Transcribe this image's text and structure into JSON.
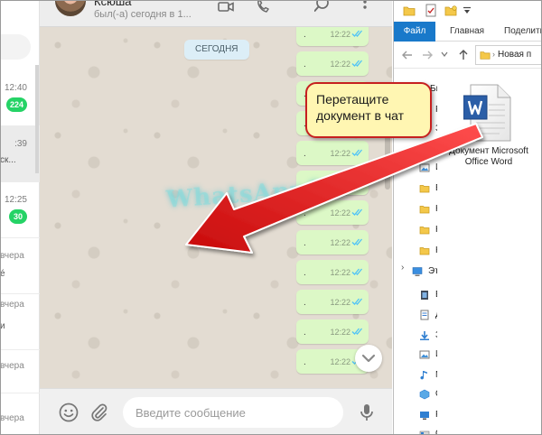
{
  "chat_list": {
    "rows": [
      {
        "time": "12:40",
        "badge": "224"
      },
      {
        "time": ":39",
        "snippet": "ск..."
      },
      {
        "time": "12:25",
        "badge": "30"
      },
      {
        "day": "вчера",
        "snippet": "é"
      },
      {
        "day": "вчера",
        "snippet": "и"
      },
      {
        "day": "вчера"
      },
      {
        "day": "вчера"
      }
    ]
  },
  "chat_header": {
    "contact_name": "Ксюша",
    "last_seen": "был(-а) сегодня в 1..."
  },
  "chat": {
    "date_divider": "СЕГОДНЯ",
    "message_time": "12:22",
    "message_dot": "."
  },
  "composer": {
    "placeholder": "Введите сообщение"
  },
  "watermark": "WhatsApp0a",
  "callout": {
    "text": "Перетащите документ в чат"
  },
  "explorer": {
    "tabs": [
      "Файл",
      "Главная",
      "Поделить"
    ],
    "address": "Новая п",
    "nav_items": [
      {
        "label": "Быстр",
        "icon": "quick-access-icon"
      },
      {
        "label": "Ра",
        "icon": "desktop-icon"
      },
      {
        "label": "За",
        "icon": "downloads-icon"
      },
      {
        "label": "Из",
        "icon": "images-icon"
      },
      {
        "label": "Вс",
        "icon": "folder-icon"
      },
      {
        "label": "Ка",
        "icon": "folder-icon"
      },
      {
        "label": "Ка",
        "icon": "folder-icon"
      },
      {
        "label": "Ка",
        "icon": "folder-icon"
      },
      {
        "label": "Это",
        "icon": "computer-icon"
      },
      {
        "label": "Ви",
        "icon": "video-icon"
      },
      {
        "label": "До",
        "icon": "documents-icon"
      },
      {
        "label": "За",
        "icon": "downloads-icon"
      },
      {
        "label": "Из",
        "icon": "images-icon"
      },
      {
        "label": "М",
        "icon": "music-icon"
      },
      {
        "label": "Об",
        "icon": "3d-objects-icon"
      },
      {
        "label": "Ра",
        "icon": "desktop-icon"
      },
      {
        "label": "OS",
        "icon": "drive-icon"
      }
    ],
    "file": {
      "label": "Документ Microsoft Office Word",
      "icon": "word-document-icon"
    }
  },
  "colors": {
    "outgoing_bubble": "#dcf8c6",
    "unread_badge": "#25d366",
    "read_tick": "#4fc3f7",
    "callout_bg": "#fff6b2",
    "callout_border": "#c62020",
    "arrow": "#e01515",
    "explorer_file_tab": "#1979ca"
  }
}
